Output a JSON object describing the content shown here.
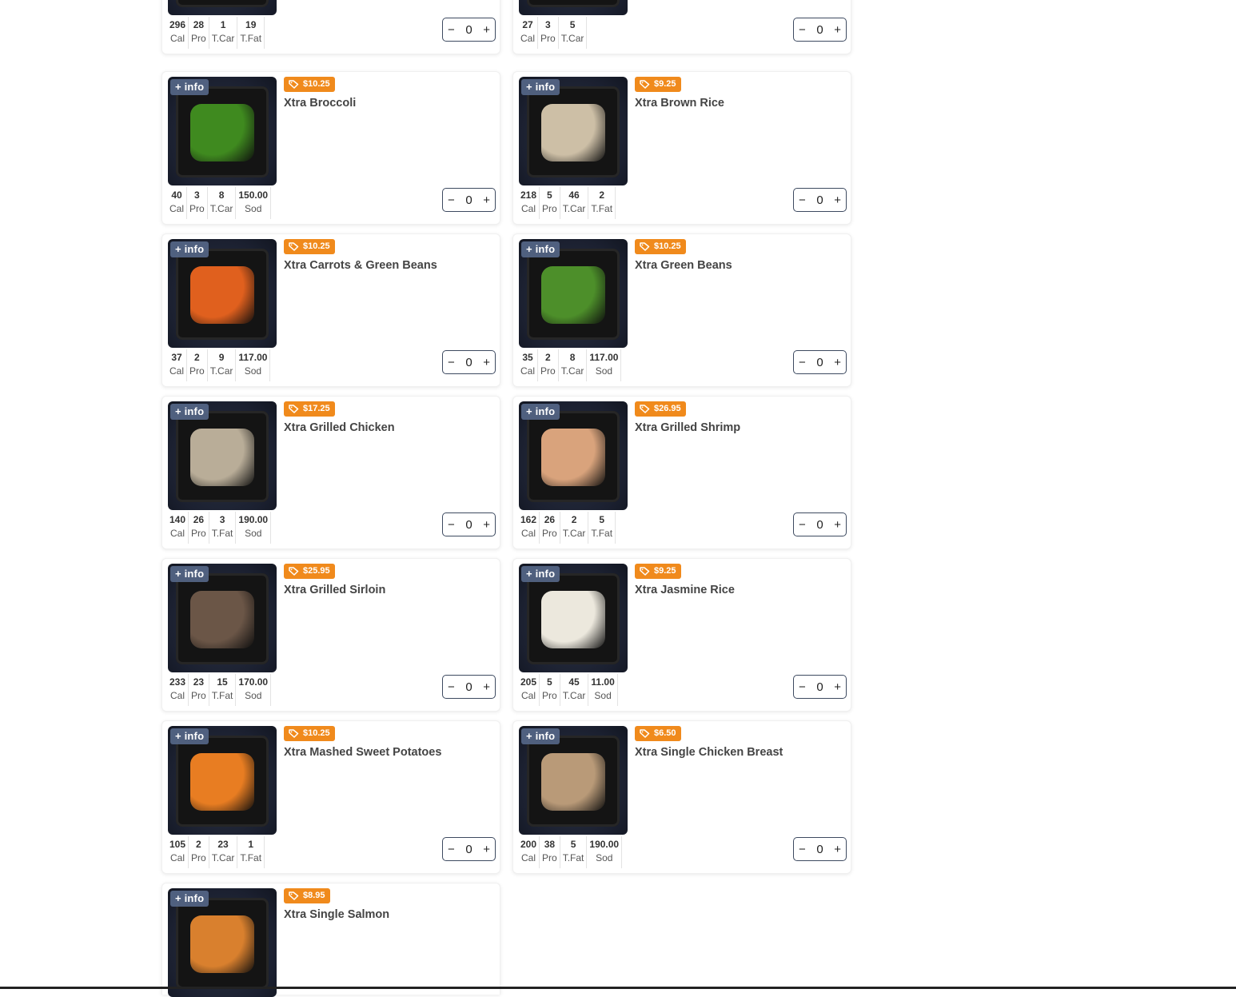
{
  "info_label": "+ info",
  "colors": {
    "price_badge": "#f08a1c",
    "info_badge": "#556687",
    "stepper_border": "#3d4a60"
  },
  "cards": [
    {
      "name": "",
      "price": "",
      "qty": "0",
      "food_color": "#8a5a3a",
      "partial": "top",
      "nutrition": [
        {
          "v": "296",
          "l": "Cal"
        },
        {
          "v": "28",
          "l": "Pro"
        },
        {
          "v": "1",
          "l": "T.Car"
        },
        {
          "v": "19",
          "l": "T.Fat"
        }
      ]
    },
    {
      "name": "",
      "price": "",
      "qty": "0",
      "food_color": "#5c8a2e",
      "partial": "top",
      "nutrition": [
        {
          "v": "27",
          "l": "Cal"
        },
        {
          "v": "3",
          "l": "Pro"
        },
        {
          "v": "5",
          "l": "T.Car"
        }
      ]
    },
    {
      "name": "Xtra Broccoli",
      "price": "$10.25",
      "qty": "0",
      "food_color": "#3f8a1f",
      "nutrition": [
        {
          "v": "40",
          "l": "Cal"
        },
        {
          "v": "3",
          "l": "Pro"
        },
        {
          "v": "8",
          "l": "T.Car"
        },
        {
          "v": "150.00",
          "l": "Sod"
        }
      ]
    },
    {
      "name": "Xtra Brown Rice",
      "price": "$9.25",
      "qty": "0",
      "food_color": "#cdbfa6",
      "nutrition": [
        {
          "v": "218",
          "l": "Cal"
        },
        {
          "v": "5",
          "l": "Pro"
        },
        {
          "v": "46",
          "l": "T.Car"
        },
        {
          "v": "2",
          "l": "T.Fat"
        }
      ]
    },
    {
      "name": "Xtra Carrots & Green Beans",
      "price": "$10.25",
      "qty": "0",
      "food_color": "#e0601e",
      "nutrition": [
        {
          "v": "37",
          "l": "Cal"
        },
        {
          "v": "2",
          "l": "Pro"
        },
        {
          "v": "9",
          "l": "T.Car"
        },
        {
          "v": "117.00",
          "l": "Sod"
        }
      ]
    },
    {
      "name": "Xtra Green Beans",
      "price": "$10.25",
      "qty": "0",
      "food_color": "#4d8f2a",
      "nutrition": [
        {
          "v": "35",
          "l": "Cal"
        },
        {
          "v": "2",
          "l": "Pro"
        },
        {
          "v": "8",
          "l": "T.Car"
        },
        {
          "v": "117.00",
          "l": "Sod"
        }
      ]
    },
    {
      "name": "Xtra Grilled Chicken",
      "price": "$17.25",
      "qty": "0",
      "food_color": "#b9ad98",
      "nutrition": [
        {
          "v": "140",
          "l": "Cal"
        },
        {
          "v": "26",
          "l": "Pro"
        },
        {
          "v": "3",
          "l": "T.Fat"
        },
        {
          "v": "190.00",
          "l": "Sod"
        }
      ]
    },
    {
      "name": "Xtra Grilled Shrimp",
      "price": "$26.95",
      "qty": "0",
      "food_color": "#d9a37c",
      "nutrition": [
        {
          "v": "162",
          "l": "Cal"
        },
        {
          "v": "26",
          "l": "Pro"
        },
        {
          "v": "2",
          "l": "T.Car"
        },
        {
          "v": "5",
          "l": "T.Fat"
        }
      ]
    },
    {
      "name": "Xtra Grilled Sirloin",
      "price": "$25.95",
      "qty": "0",
      "food_color": "#6b5647",
      "nutrition": [
        {
          "v": "233",
          "l": "Cal"
        },
        {
          "v": "23",
          "l": "Pro"
        },
        {
          "v": "15",
          "l": "T.Fat"
        },
        {
          "v": "170.00",
          "l": "Sod"
        }
      ]
    },
    {
      "name": "Xtra Jasmine Rice",
      "price": "$9.25",
      "qty": "0",
      "food_color": "#ece8dd",
      "nutrition": [
        {
          "v": "205",
          "l": "Cal"
        },
        {
          "v": "5",
          "l": "Pro"
        },
        {
          "v": "45",
          "l": "T.Car"
        },
        {
          "v": "11.00",
          "l": "Sod"
        }
      ]
    },
    {
      "name": "Xtra Mashed Sweet Potatoes",
      "price": "$10.25",
      "qty": "0",
      "food_color": "#e87d22",
      "nutrition": [
        {
          "v": "105",
          "l": "Cal"
        },
        {
          "v": "2",
          "l": "Pro"
        },
        {
          "v": "23",
          "l": "T.Car"
        },
        {
          "v": "1",
          "l": "T.Fat"
        }
      ]
    },
    {
      "name": "Xtra Single Chicken Breast",
      "price": "$6.50",
      "qty": "0",
      "food_color": "#b99a78",
      "nutrition": [
        {
          "v": "200",
          "l": "Cal"
        },
        {
          "v": "38",
          "l": "Pro"
        },
        {
          "v": "5",
          "l": "T.Fat"
        },
        {
          "v": "190.00",
          "l": "Sod"
        }
      ]
    },
    {
      "name": "Xtra Single Salmon",
      "price": "$8.95",
      "qty": "",
      "food_color": "#d9802e",
      "partial": "bottom",
      "nutrition": []
    }
  ]
}
